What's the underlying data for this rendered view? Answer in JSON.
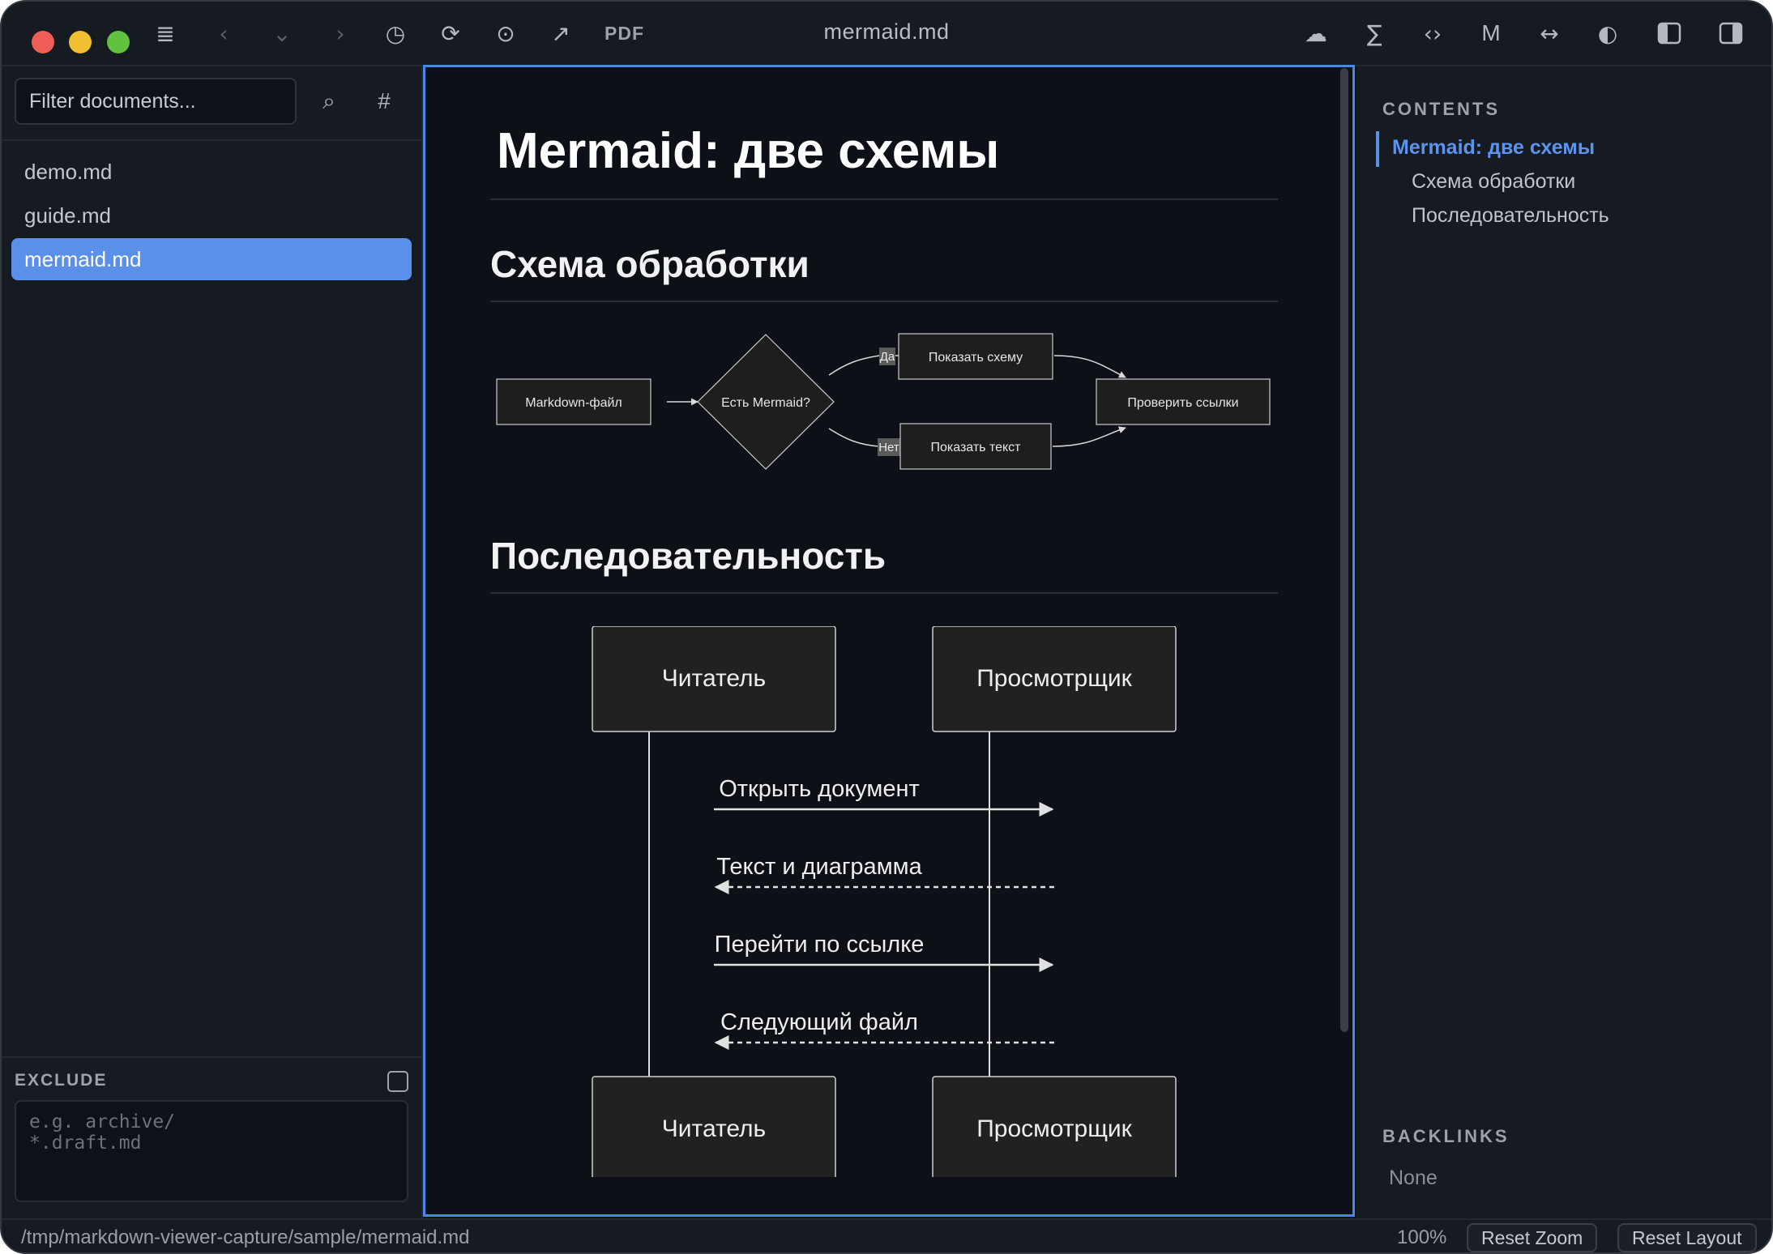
{
  "window": {
    "title": "mermaid.md"
  },
  "toolbar": {
    "sidebar_toggle_icon": "≣",
    "back_icon": "‹",
    "down_icon": "⌄",
    "forward_icon": "›",
    "history_icon": "◷",
    "reload_icon": "⟳",
    "target_icon": "⊙",
    "open_external_icon": "↗",
    "pdf_label": "PDF",
    "cloud_icon": "☁",
    "sum_icon": "∑",
    "code_icon": "‹›",
    "markdown_icon": "M",
    "width_icon": "↔",
    "contrast_icon": "◐",
    "left_panel_icon": "▮",
    "right_panel_icon": "▮"
  },
  "sidebar": {
    "filter_placeholder": "Filter documents...",
    "search_icon": "⌕",
    "hash_icon": "#",
    "files": [
      {
        "name": "demo.md",
        "active": false
      },
      {
        "name": "guide.md",
        "active": false
      },
      {
        "name": "mermaid.md",
        "active": true
      }
    ],
    "exclude_label": "EXCLUDE",
    "exclude_placeholder": "e.g. archive/\n*.draft.md"
  },
  "document": {
    "title": "Mermaid: две схемы",
    "section1": "Схема обработки",
    "section2": "Последовательность",
    "flowchart": {
      "node_markdown": "Markdown-файл",
      "node_decision": "Есть Mermaid?",
      "node_show_diagram": "Показать схему",
      "node_show_text": "Показать текст",
      "node_check_links": "Проверить ссылки",
      "edge_yes": "Да",
      "edge_no": "Нет"
    },
    "sequence": {
      "actor_reader": "Читатель",
      "actor_viewer": "Просмотрщик",
      "msg1": "Открыть документ",
      "msg2": "Текст и диаграмма",
      "msg3": "Перейти по ссылке",
      "msg4": "Следующий файл"
    }
  },
  "toc": {
    "heading": "CONTENTS",
    "items": [
      {
        "label": "Mermaid: две схемы",
        "active": true
      },
      {
        "label": "Схема обработки",
        "active": false
      },
      {
        "label": "Последовательность",
        "active": false
      }
    ],
    "backlinks_heading": "BACKLINKS",
    "backlinks_none": "None"
  },
  "status": {
    "path": "/tmp/markdown-viewer-capture/sample/mermaid.md",
    "zoom": "100%",
    "reset_zoom": "Reset Zoom",
    "reset_layout": "Reset Layout"
  },
  "colors": {
    "accent": "#5a8fea",
    "background": "#0d1016",
    "panel": "#161a21"
  }
}
